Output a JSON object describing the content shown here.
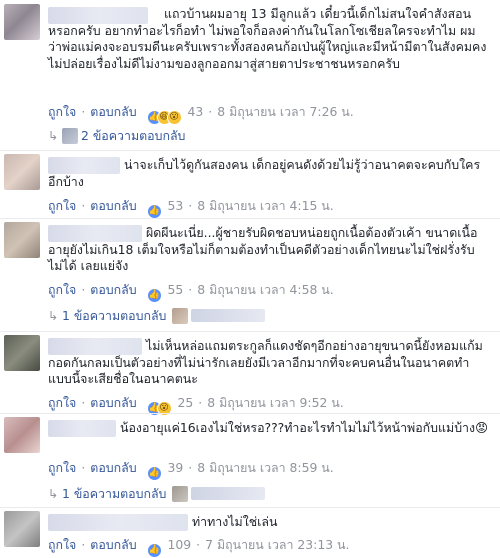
{
  "actions": {
    "like": "ถูกใจ",
    "reply": "ตอบกลับ",
    "separator": "·"
  },
  "comments": [
    {
      "text": "แถวบ้านผมอายุ 13 มีลูกแล้ว เดี๋ยวนี้เด็กไม่สนใจคำสังสอนหรอกครับ อยากทำอะไรก็อทำ ไม่พอใจก็อลงค่ากันในโลกโซเชียลใครจะทำไม ผมว่าพ่อแม่คงจะอบรมดีนะครับเพราะทั้งสองคนก้อเป่นผู้ใหญ่และมีหน้ามีตาในสังคมคงไม่ปล่อยเรื่องไม่ดีไม่งามของลูกออกมาสู่สายตาประชาชนหรอกครับ",
      "reaction_count": "43",
      "reactions": [
        "like",
        "haha",
        "wow"
      ],
      "time": "8 มิถุนายน เวลา 7:26 น.",
      "replies": "2 ข้อความตอบกลับ"
    },
    {
      "text": "น่าจะเก็บไว้ดูกันสองคน เด็กอยู่คนดังด้วยไม่รู้ว่าอนาคตจะคบกับใครอีกบ้าง",
      "reaction_count": "53",
      "reactions": [
        "like"
      ],
      "time": "8 มิถุนายน เวลา 4:15 น."
    },
    {
      "text": "ผิดผีนะเนี่ย...ผู้ชายรับผิดชอบหน่อยถูกเนื้อต้องตัวเค้า ขนาดเนื้ออายุยังไม่เกิน18 เต็มใจหรือไม่ก็ตามต้องทำเป็นคดีตัวอย่างเด็กไทยนะไม่ใช่ฝรั่งรับไม่ได้ เลยแย่จัง",
      "reaction_count": "55",
      "reactions": [
        "like"
      ],
      "time": "8 มิถุนายน เวลา 4:58 น.",
      "replies": "1 ข้อความตอบกลับ"
    },
    {
      "text": "ไม่เห็นหล่อแถมตระกูลก็แดงชัดๆอีกอย่างอายุขนาดนี้ยังหอมแก้มกอดกันกลมเป็นตัวอย่างที่ไม่น่ารักเลยยังมีเวลาอีกมากที่จะคบคนอื่นในอนาคตทำแบบนี้จะเสียชื่อในอนาคตนะ",
      "reaction_count": "25",
      "reactions": [
        "like",
        "wow"
      ],
      "time": "8 มิถุนายน เวลา 9:52 น."
    },
    {
      "text": "น้องอายุแค่16เองไม่ใช่หรอ???ทำอะไรทำไมไม่ไว้หน้าพ่อกับแม่บ้าง😡",
      "reaction_count": "39",
      "reactions": [
        "like"
      ],
      "time": "8 มิถุนายน เวลา 8:59 น.",
      "replies": "1 ข้อความตอบกลับ"
    },
    {
      "text": "ท่าทางไม่ใช่เล่น",
      "reaction_count": "109",
      "reactions": [
        "like"
      ],
      "time": "7 มิถุนายน เวลา 23:13 น."
    }
  ]
}
